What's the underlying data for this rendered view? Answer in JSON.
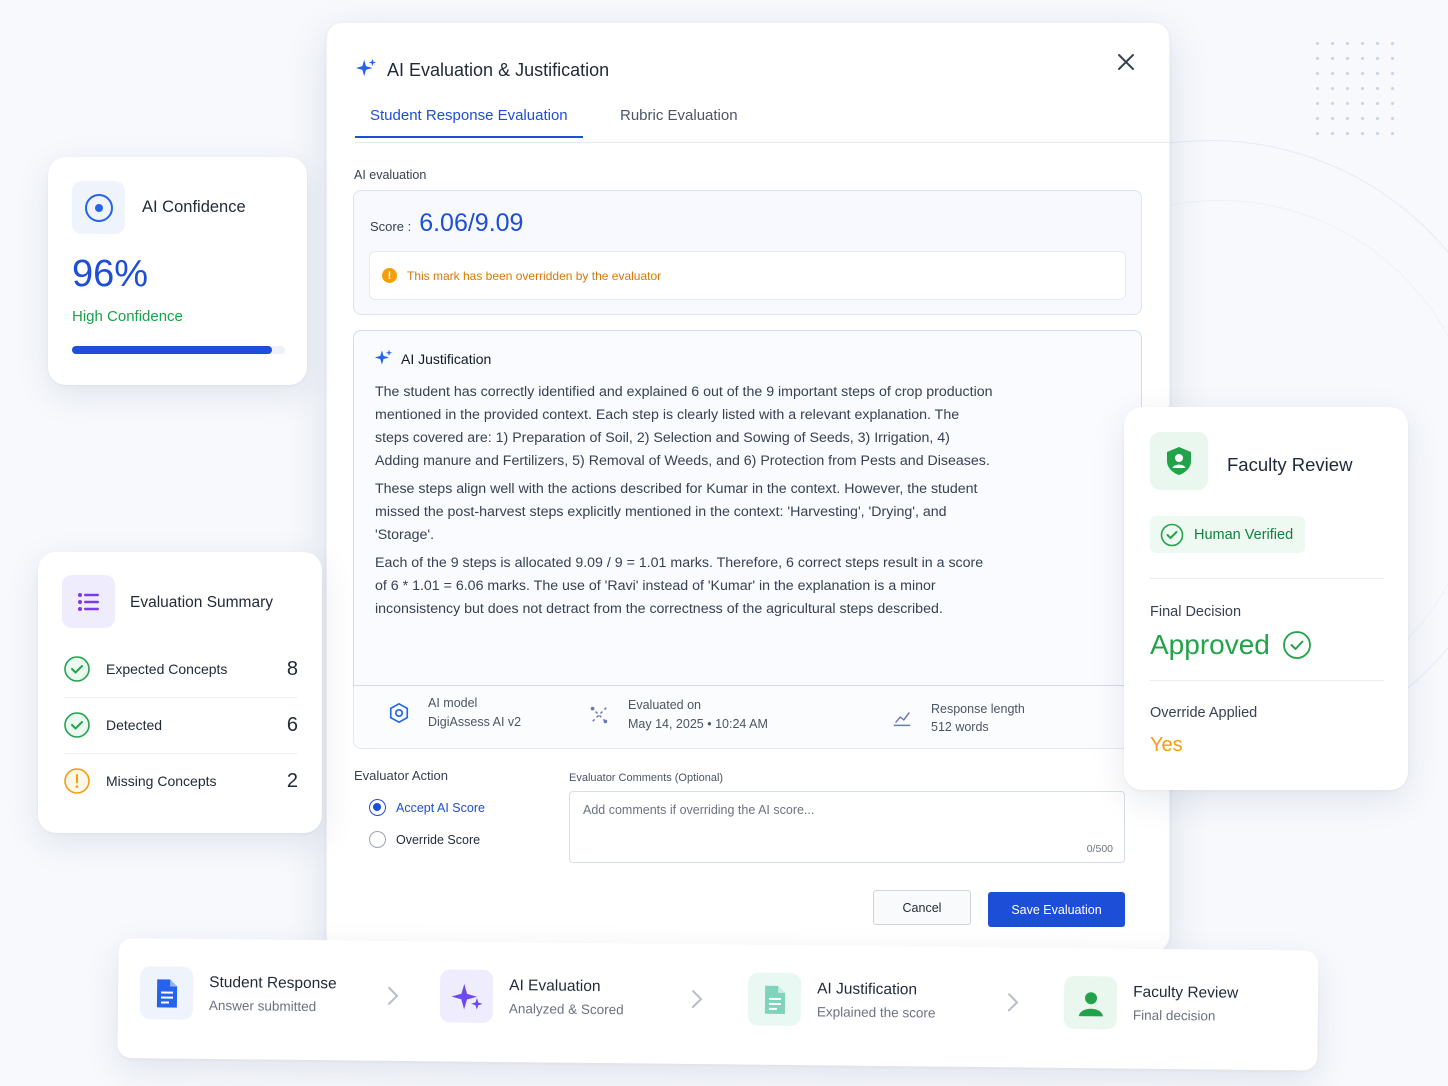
{
  "modal": {
    "title": "AI Evaluation & Justification",
    "tabs": [
      {
        "label": "Student Response Evaluation",
        "active": true
      },
      {
        "label": "Rubric Evaluation",
        "active": false
      }
    ],
    "section_label": "AI evaluation",
    "score_label": "Score :",
    "score_value": "6.06/9.09",
    "override_note": "This mark has been overridden by the evaluator",
    "justification_title": "AI Justification",
    "justification_paragraphs": [
      "The student has correctly identified and explained 6 out of the 9 important steps of crop production mentioned in the provided context. Each step is clearly listed with a relevant explanation. The steps covered are: 1) Preparation of Soil, 2) Selection and Sowing of Seeds, 3) Irrigation, 4) Adding manure and Fertilizers, 5) Removal of Weeds, and 6) Protection from Pests and Diseases.",
      "These steps align well with the actions described for Kumar in the context. However, the student missed the post-harvest steps explicitly mentioned in the context: 'Harvesting', 'Drying', and 'Storage'.",
      "Each of the 9 steps is allocated 9.09 / 9 = 1.01 marks. Therefore, 6 correct steps result in a score of 6 * 1.01 = 6.06 marks. The use of 'Ravi' instead of 'Kumar' in the explanation is a minor inconsistency but does not detract from the correctness of the agricultural steps described."
    ],
    "meta": {
      "model_label": "AI model",
      "model_value": "DigiAssess AI v2",
      "evaluated_label": "Evaluated on",
      "evaluated_value": "May 14, 2025 • 10:24 AM",
      "length_label": "Response length",
      "length_value": "512 words"
    },
    "evaluator_action_label": "Evaluator Action",
    "options": [
      "Accept AI Score",
      "Override Score"
    ],
    "selected_option": "Accept AI Score",
    "comments_label": "Evaluator Comments (Optional)",
    "comments_placeholder": "Add comments if overriding the AI score...",
    "char_count": "0/500",
    "cancel_label": "Cancel",
    "save_label": "Save Evaluation"
  },
  "confidence": {
    "title": "AI Confidence",
    "value": "96%",
    "level": "High Confidence",
    "progress": 0.94
  },
  "summary": {
    "title": "Evaluation Summary",
    "rows": [
      {
        "label": "Expected Concepts",
        "count": "8",
        "status": "ok"
      },
      {
        "label": "Detected",
        "count": "6",
        "status": "ok"
      },
      {
        "label": "Missing Concepts",
        "count": "2",
        "status": "warn"
      }
    ]
  },
  "faculty": {
    "title": "Faculty Review",
    "badge": "Human Verified",
    "decision_label": "Final Decision",
    "decision_value": "Approved",
    "override_label": "Override Applied",
    "override_value": "Yes"
  },
  "workflow": [
    {
      "title": "Student Response",
      "subtitle": "Answer submitted",
      "icon": "document-icon"
    },
    {
      "title": "AI Evaluation",
      "subtitle": "Analyzed & Scored",
      "icon": "sparkle-icon"
    },
    {
      "title": "AI Justification",
      "subtitle": "Explained the score",
      "icon": "notes-icon"
    },
    {
      "title": "Faculty Review",
      "subtitle": "Final decision",
      "icon": "user-icon"
    }
  ],
  "colors": {
    "accent": "#1d4ed8",
    "success": "#22a34a",
    "warning": "#f59e0b"
  }
}
